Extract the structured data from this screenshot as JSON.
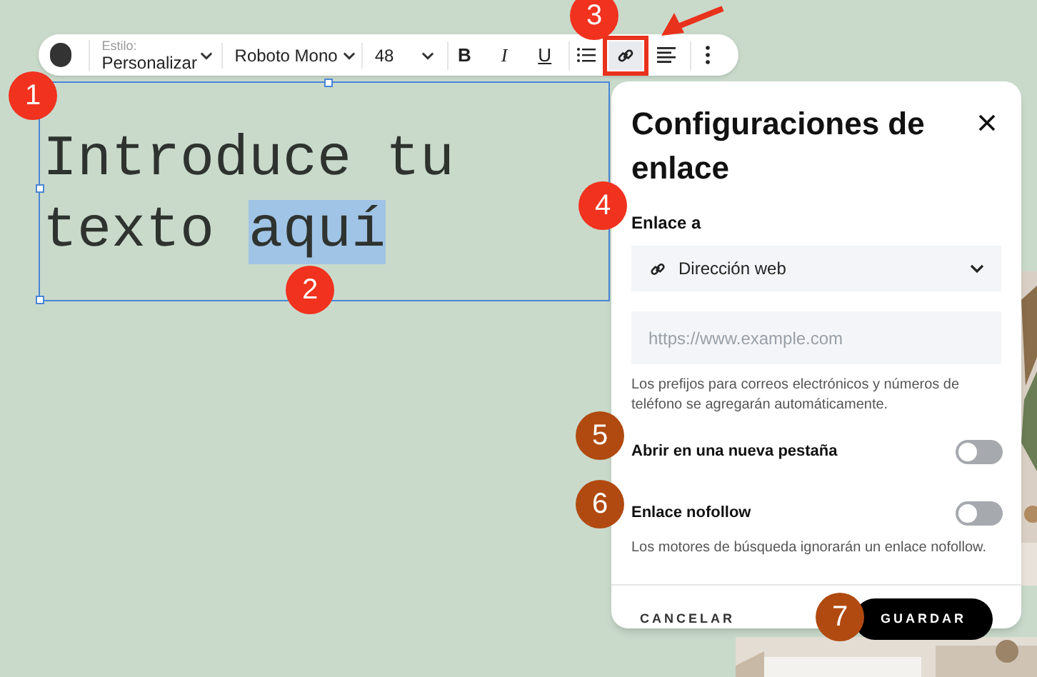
{
  "toolbar": {
    "style_label": "Estilo:",
    "style_value": "Personalizar",
    "font": "Roboto Mono",
    "size": "48",
    "buttons": [
      {
        "kind": "bold",
        "label": "B",
        "selected": false
      },
      {
        "kind": "italic",
        "label": "I",
        "selected": false
      },
      {
        "kind": "underline",
        "label": "U",
        "selected": false
      },
      {
        "kind": "list",
        "selected": false
      },
      {
        "kind": "link",
        "selected": true
      },
      {
        "kind": "align",
        "selected": false
      },
      {
        "kind": "more",
        "selected": false
      }
    ]
  },
  "text_box": {
    "lines": [
      [
        {
          "text": "Introduce tu",
          "selected": false
        }
      ],
      [
        {
          "text": "texto ",
          "selected": false
        },
        {
          "text": "aquí",
          "selected": true
        }
      ]
    ]
  },
  "panel": {
    "title": "Configuraciones de enlace",
    "link_to_label": "Enlace a",
    "link_type": "Dirección web",
    "url_placeholder": "https://www.example.com",
    "url_hint": "Los prefijos para correos electrónicos y números de teléfono se agregarán automáticamente.",
    "toggles": [
      {
        "label": "Abrir en una nueva pestaña",
        "on": false
      },
      {
        "label": "Enlace nofollow",
        "on": false,
        "hint": "Los motores de búsqueda ignorarán un enlace nofollow."
      }
    ],
    "cancel": "CANCELAR",
    "save": "GUARDAR"
  },
  "annotations": [
    {
      "label": "1",
      "color": "#f0321e"
    },
    {
      "label": "2",
      "color": "#f0321e"
    },
    {
      "label": "3",
      "color": "#f0321e"
    },
    {
      "label": "4",
      "color": "#f0321e"
    },
    {
      "label": "5",
      "color": "#b04a10"
    },
    {
      "label": "6",
      "color": "#b04a10"
    },
    {
      "label": "7",
      "color": "#b04a10"
    }
  ]
}
